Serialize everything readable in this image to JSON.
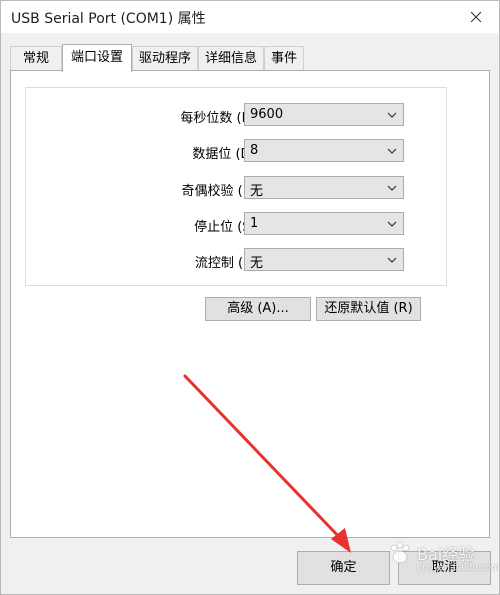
{
  "window": {
    "title": "USB Serial Port (COM1) 属性"
  },
  "tabs": [
    {
      "label": "常规"
    },
    {
      "label": "端口设置"
    },
    {
      "label": "驱动程序"
    },
    {
      "label": "详细信息"
    },
    {
      "label": "事件"
    }
  ],
  "active_tab": "端口设置",
  "settings": [
    {
      "label": "每秒位数 (B):",
      "value": "9600"
    },
    {
      "label": "数据位 (D):",
      "value": "8"
    },
    {
      "label": "奇偶校验 (P):",
      "value": "无"
    },
    {
      "label": "停止位 (S):",
      "value": "1"
    },
    {
      "label": "流控制 (F):",
      "value": "无"
    }
  ],
  "buttons": {
    "advanced": "高级 (A)...",
    "restore_defaults": "还原默认值 (R)",
    "ok": "确定",
    "cancel": "取消"
  },
  "watermark": {
    "brand": "Bai经验",
    "url": "jingyan.baidu.com"
  },
  "colors": {
    "annotation_arrow": "#e8322d",
    "window_bg": "#f0f0f0",
    "panel_bg": "#ffffff",
    "select_bg": "#e5e5e5",
    "button_bg": "#e1e1e1"
  },
  "icons": {
    "close": "close-icon",
    "dropdown": "chevron-down-icon"
  }
}
